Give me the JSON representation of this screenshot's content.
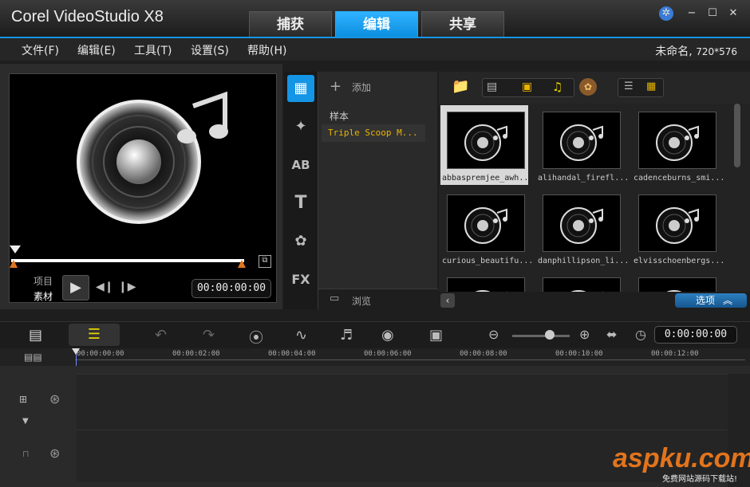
{
  "app": {
    "title": "Corel VideoStudio X8"
  },
  "main_tabs": [
    {
      "label": "捕获"
    },
    {
      "label": "编辑"
    },
    {
      "label": "共享"
    }
  ],
  "menu": [
    {
      "label": "文件(F)"
    },
    {
      "label": "编辑(E)"
    },
    {
      "label": "工具(T)"
    },
    {
      "label": "设置(S)"
    },
    {
      "label": "帮助(H)"
    }
  ],
  "project": {
    "name": "未命名",
    "resolution": "720*576"
  },
  "preview": {
    "mode_project": "项目",
    "mode_clip": "素材",
    "timecode": "00:00:00:00"
  },
  "library": {
    "add_label": "添加",
    "folders": [
      {
        "label": "样本"
      },
      {
        "label": "Triple Scoop M..."
      }
    ],
    "browse_label": "浏览",
    "options_label": "选项",
    "thumbnails": [
      {
        "caption": "abbaspremjee_awh..."
      },
      {
        "caption": "alihandal_firefl..."
      },
      {
        "caption": "cadenceburns_smi..."
      },
      {
        "caption": "curious_beautifu..."
      },
      {
        "caption": "danphillipson_li..."
      },
      {
        "caption": "elvisschoenbergs..."
      },
      {
        "caption": ""
      },
      {
        "caption": ""
      },
      {
        "caption": ""
      }
    ]
  },
  "timeline": {
    "timecode": "0:00:00:00",
    "ruler": [
      "00:00:00:00",
      "00:00:02:00",
      "00:00:04:00",
      "00:00:06:00",
      "00:00:08:00",
      "00:00:10:00",
      "00:00:12:00"
    ],
    "add_tracks_label": "+/-"
  },
  "watermark": {
    "text": "aspku.com",
    "subtitle": "免费网站源码下载站!"
  },
  "colors": {
    "accent": "#1495e6",
    "brand_orange": "#e2741c"
  }
}
